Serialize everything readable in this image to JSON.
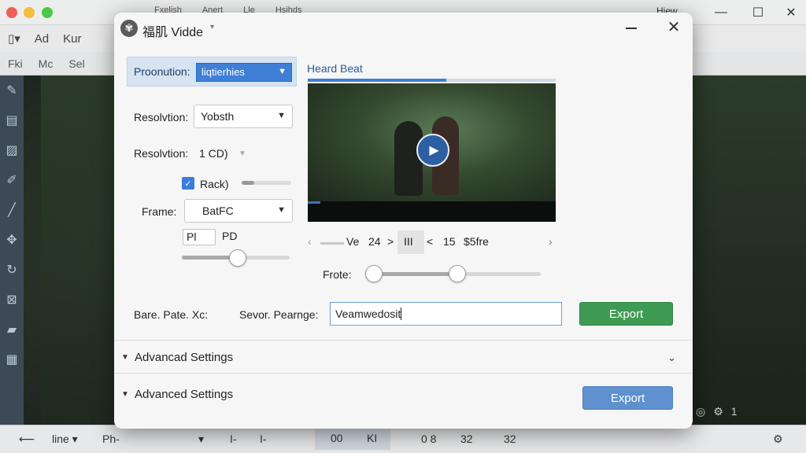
{
  "background_app": {
    "menu": [
      "Fxelish",
      "Anert",
      "Lle",
      "Hsihds"
    ],
    "view_label": "Hiew",
    "toolbar1": [
      "Ad",
      "Kur"
    ],
    "toolbar2": [
      "Fki",
      "Mc",
      "Sel"
    ],
    "bottombar": {
      "line_label": "line",
      "ph_label": "Ph-",
      "items": [
        "I-",
        "I-",
        "00",
        "KI",
        "0 8",
        "32",
        "32"
      ]
    },
    "canvas_badge": "1"
  },
  "dialog": {
    "title": "福肌 Vidde",
    "app_icon": "fan-logo-icon",
    "pronunciation": {
      "label": "Proonution:",
      "value": "liqtierhies"
    },
    "resolution1": {
      "label": "Resolvtion:",
      "value": "Yobsth"
    },
    "resolution2": {
      "label": "Resolvtion:",
      "value": "1 CD)"
    },
    "checkbox": {
      "label": "Rack)",
      "checked": true,
      "slider_level": 0.25
    },
    "frame": {
      "label": "Frame:",
      "value": "BatFC"
    },
    "pl": {
      "value": "Pl",
      "label": "PD",
      "slider_level": 0.52
    },
    "preview": {
      "title": "Heard Beat",
      "bar_progress": 0.56,
      "video_progress": 0.05
    },
    "nav": {
      "prev": "‹",
      "label": "Ve",
      "num1": "24",
      "gt": ">",
      "pause": "III",
      "lt": "<",
      "num2": "15",
      "rate": "$5fre",
      "next": "›"
    },
    "frate": {
      "label": "Frote:",
      "range_low": 0,
      "range_high": 0.5
    },
    "bare_label": "Bare. Pate. Xc:",
    "sevor": {
      "label": "Sevor. Pearnge:",
      "value": "Veamwedosit"
    },
    "export_label": "Export",
    "advanced1": "Advancad Settings",
    "advanced2": "Advanced Settings",
    "export2_label": "Export"
  }
}
